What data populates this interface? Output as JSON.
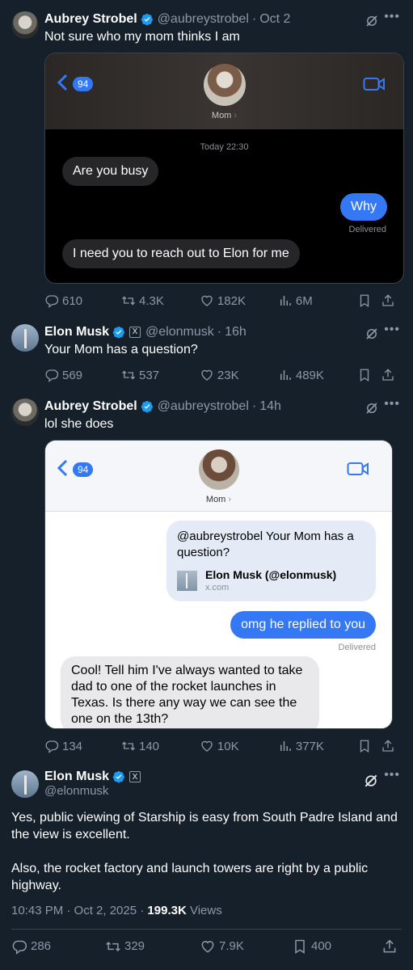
{
  "tweets": [
    {
      "name": "Aubrey Strobel",
      "handle": "@aubreystrobel",
      "time": "Oct 2",
      "text": "Not sure who my mom thinks I am",
      "embed": {
        "back_count": "94",
        "contact": "Mom",
        "timestamp": "Today 22:30",
        "messages": [
          {
            "from": "them",
            "text": "Are you busy"
          },
          {
            "from": "me",
            "text": "Why"
          },
          {
            "status": "Delivered"
          },
          {
            "from": "them",
            "text": "I need you to reach out to Elon for me"
          }
        ]
      },
      "stats": {
        "replies": "610",
        "reposts": "4.3K",
        "likes": "182K",
        "views": "6M"
      }
    },
    {
      "name": "Elon Musk",
      "handle": "@elonmusk",
      "time": "16h",
      "text": "Your Mom has a question?",
      "stats": {
        "replies": "569",
        "reposts": "537",
        "likes": "23K",
        "views": "489K"
      }
    },
    {
      "name": "Aubrey Strobel",
      "handle": "@aubreystrobel",
      "time": "14h",
      "text": "lol she does",
      "embed": {
        "back_count": "94",
        "contact": "Mom",
        "link_card": {
          "text": "@aubreystrobel Your Mom has a question?",
          "title": "Elon Musk (@elonmusk)",
          "url": "x.com"
        },
        "outgoing": "omg he replied to you",
        "status": "Delivered",
        "incoming": "Cool! Tell him I've always wanted to take dad to one of the rocket launches in Texas. Is there any way we can see the one on the 13th?"
      },
      "stats": {
        "replies": "134",
        "reposts": "140",
        "likes": "10K",
        "views": "377K"
      }
    }
  ],
  "main_tweet": {
    "name": "Elon Musk",
    "handle": "@elonmusk",
    "paragraph1": "Yes, public viewing of Starship is easy from South Padre Island and the view is excellent.",
    "paragraph2": "Also, the rocket factory and launch towers are right by a public highway.",
    "timestamp": "10:43 PM · Oct 2, 2025 · ",
    "views_count": "199.3K",
    "views_label": " Views",
    "stats": {
      "replies": "286",
      "reposts": "329",
      "likes": "7.9K",
      "bookmarks": "400"
    }
  },
  "colors": {
    "background": "#15202b",
    "verified": "#1d9bf0",
    "imessage_blue": "#3478f6",
    "muted": "#8b98a5"
  },
  "icons": [
    "verified-badge-icon",
    "grok-icon",
    "more-icon",
    "reply-icon",
    "repost-icon",
    "like-icon",
    "views-icon",
    "bookmark-icon",
    "share-icon",
    "video-camera-icon",
    "back-chevron-icon",
    "x-badge-icon"
  ]
}
